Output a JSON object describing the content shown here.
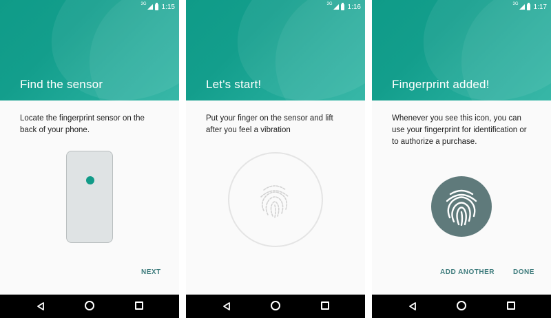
{
  "colors": {
    "accent": "#129b88",
    "action_text": "#3d7b7c",
    "badge": "#5f7a7b",
    "navbar": "#000000"
  },
  "screens": [
    {
      "status": {
        "network": "3G",
        "time": "1:15"
      },
      "title": "Find the sensor",
      "body": "Locate the fingerprint sensor on the back of your phone.",
      "actions": [
        "NEXT"
      ]
    },
    {
      "status": {
        "network": "3G",
        "time": "1:16"
      },
      "title": "Let's start!",
      "body": "Put your finger on the sensor and lift after you feel a vibration",
      "actions": []
    },
    {
      "status": {
        "network": "3G",
        "time": "1:17"
      },
      "title": "Fingerprint added!",
      "body": "Whenever you see this icon, you can use your fingerprint for identification or to authorize a purchase.",
      "actions": [
        "ADD ANOTHER",
        "DONE"
      ]
    }
  ],
  "icons": {
    "signal": "signal-icon",
    "battery": "battery-icon",
    "fingerprint": "fingerprint-icon",
    "back": "back-icon",
    "home": "home-icon",
    "recents": "recents-icon"
  }
}
